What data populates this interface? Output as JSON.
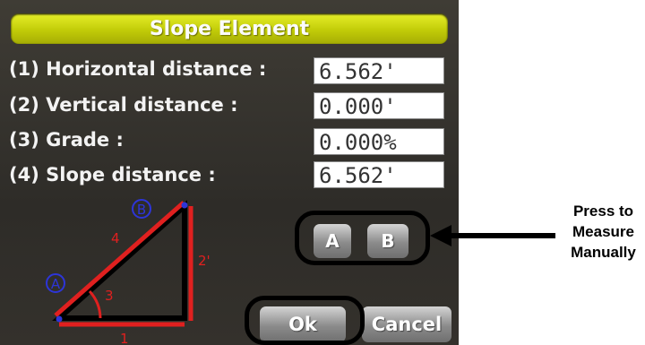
{
  "dialog": {
    "title": "Slope Element",
    "fields": [
      {
        "label": "(1) Horizontal distance :",
        "value": "6.562'"
      },
      {
        "label": "(2) Vertical distance :",
        "value": "0.000'"
      },
      {
        "label": "(3) Grade :",
        "value": "0.000%"
      },
      {
        "label": "(4) Slope distance :",
        "value": "6.562'"
      }
    ],
    "point_a_button": "A",
    "point_b_button": "B",
    "ok_button": "Ok",
    "cancel_button": "Cancel",
    "diagram": {
      "point_a": "A",
      "point_b": "B",
      "label_1": "1",
      "label_2": "2'",
      "label_3": "3",
      "label_4": "4"
    }
  },
  "annotation": {
    "callout_lines": [
      "Press to",
      "Measure",
      "Manually"
    ]
  },
  "colors": {
    "title_bar": "#c8d110",
    "panel_bg": "#34312c",
    "diagram_red": "#e0201f",
    "point_blue": "#2d35d8"
  }
}
